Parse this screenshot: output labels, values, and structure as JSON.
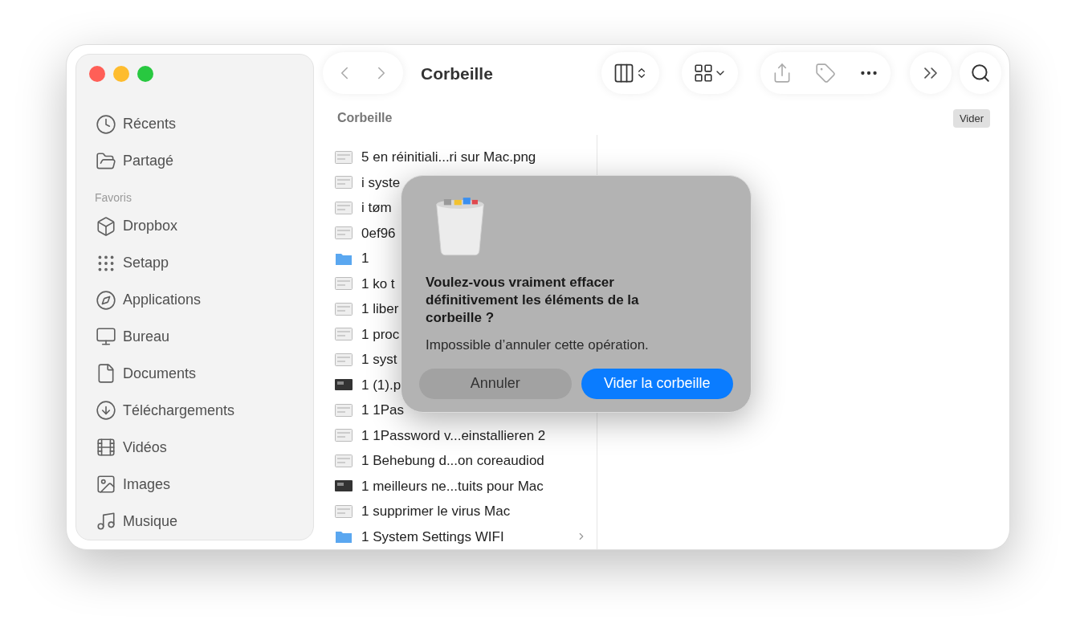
{
  "window": {
    "title": "Corbeille"
  },
  "sidebar": {
    "items": [
      {
        "label": "Récents"
      },
      {
        "label": "Partagé"
      }
    ],
    "section": "Favoris",
    "favorites": [
      {
        "label": "Dropbox"
      },
      {
        "label": "Setapp"
      },
      {
        "label": "Applications"
      },
      {
        "label": "Bureau"
      },
      {
        "label": "Documents"
      },
      {
        "label": "Téléchargements"
      },
      {
        "label": "Vidéos"
      },
      {
        "label": "Images"
      },
      {
        "label": "Musique"
      }
    ]
  },
  "path_header": "Corbeille",
  "empty_button": "Vider",
  "files": [
    {
      "name": "5 en réinitiali...ri sur Mac.png",
      "kind": "file"
    },
    {
      "name": "i syste",
      "kind": "file"
    },
    {
      "name": "i tøm",
      "kind": "file"
    },
    {
      "name": "0ef96",
      "kind": "file"
    },
    {
      "name": "1",
      "kind": "folder"
    },
    {
      "name": "1  ko t",
      "kind": "file"
    },
    {
      "name": "1  liber",
      "kind": "file"
    },
    {
      "name": "1  proc",
      "kind": "file"
    },
    {
      "name": "1  syst",
      "kind": "file"
    },
    {
      "name": "1 (1).p",
      "kind": "dark"
    },
    {
      "name": "1 1Pas",
      "kind": "file"
    },
    {
      "name": "1 1Password v...einstallieren 2",
      "kind": "file"
    },
    {
      "name": "1 Behebung d...on coreaudiod",
      "kind": "file"
    },
    {
      "name": "1 meilleurs ne...tuits pour Mac",
      "kind": "dark"
    },
    {
      "name": "1 supprimer le virus Mac",
      "kind": "file"
    },
    {
      "name": "1 System Settings WIFI",
      "kind": "folder",
      "expandable": true
    }
  ],
  "dialog": {
    "title": "Voulez-vous vraiment effacer définitivement les éléments de la corbeille ?",
    "message": "Impossible d’annuler cette opération.",
    "buttons": [
      {
        "label": "Annuler",
        "kind": "cancel"
      },
      {
        "label": "Vider la corbeille",
        "kind": "default"
      }
    ]
  }
}
